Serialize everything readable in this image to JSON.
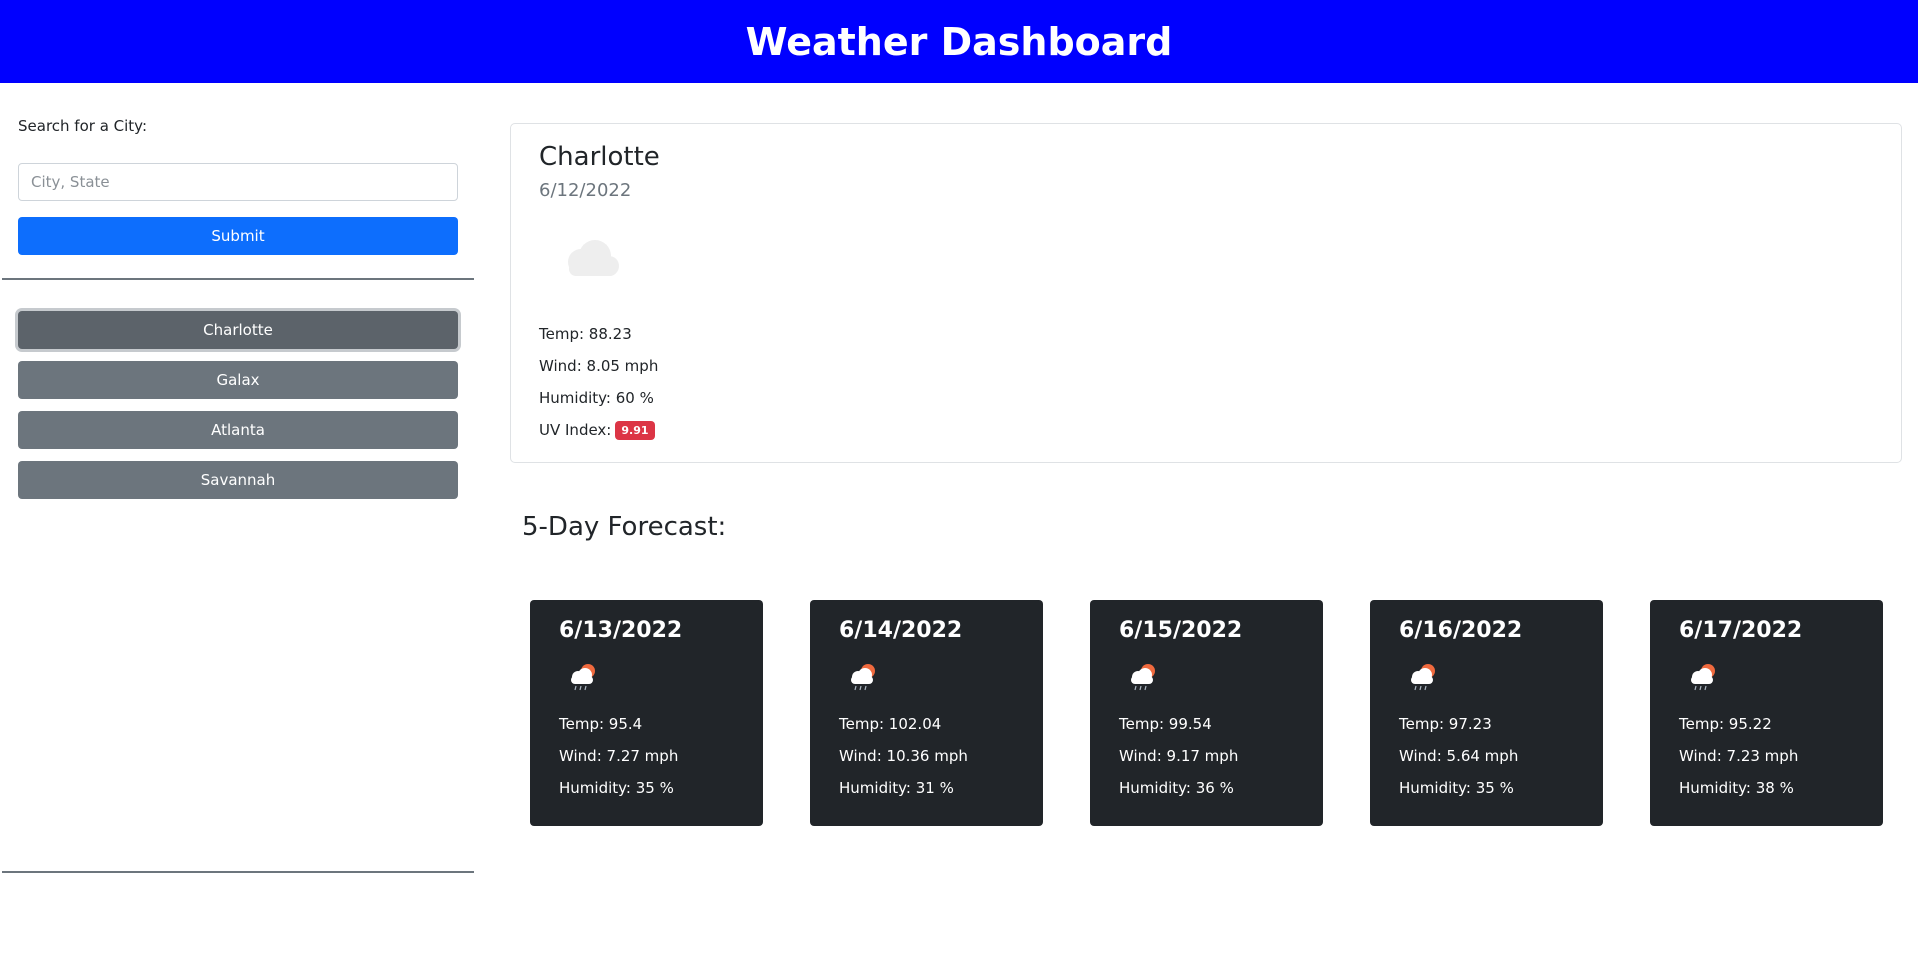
{
  "header": {
    "title": "Weather Dashboard"
  },
  "search": {
    "label": "Search for a City:",
    "placeholder": "City, State",
    "value": "",
    "submit_label": "Submit"
  },
  "history": [
    "Charlotte",
    "Galax",
    "Atlanta",
    "Savannah"
  ],
  "current": {
    "city": "Charlotte",
    "date": "6/12/2022",
    "icon": "cloud-icon",
    "temp": "Temp: 88.23",
    "wind": "Wind: 8.05 mph",
    "humidity": "Humidity: 60 %",
    "uv_label": "UV Index:",
    "uv_value": "9.91",
    "uv_color": "#dc3545"
  },
  "forecast": {
    "title": "5-Day Forecast:",
    "days": [
      {
        "date": "6/13/2022",
        "icon": "sun-cloud-rain-icon",
        "temp": "Temp: 95.4",
        "wind": "Wind: 7.27 mph",
        "humidity": "Humidity: 35 %"
      },
      {
        "date": "6/14/2022",
        "icon": "sun-cloud-rain-icon",
        "temp": "Temp: 102.04",
        "wind": "Wind: 10.36 mph",
        "humidity": "Humidity: 31 %"
      },
      {
        "date": "6/15/2022",
        "icon": "sun-cloud-rain-icon",
        "temp": "Temp: 99.54",
        "wind": "Wind: 9.17 mph",
        "humidity": "Humidity: 36 %"
      },
      {
        "date": "6/16/2022",
        "icon": "sun-cloud-rain-icon",
        "temp": "Temp: 97.23",
        "wind": "Wind: 5.64 mph",
        "humidity": "Humidity: 35 %"
      },
      {
        "date": "6/17/2022",
        "icon": "sun-cloud-rain-icon",
        "temp": "Temp: 95.22",
        "wind": "Wind: 7.23 mph",
        "humidity": "Humidity: 38 %"
      }
    ]
  },
  "colors": {
    "header_bg": "#0000ff",
    "submit_bg": "#0d6efd",
    "history_bg": "#6c757d",
    "forecast_card_bg": "#212529"
  }
}
